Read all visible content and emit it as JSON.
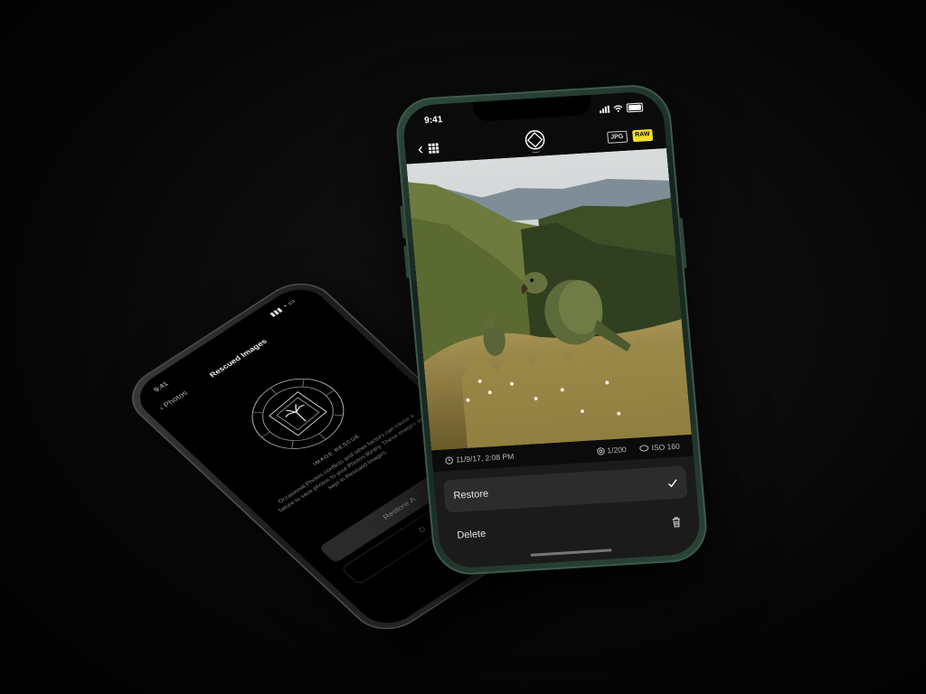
{
  "back_phone": {
    "status_time": "9:41",
    "nav_back_label": "Photos",
    "nav_title": "Rescued Images",
    "section_heading": "IMAGE RESCUE",
    "body_text": "Occasional Photos conflicts and other factors can cause a failure to save photos to your Photos library. These images are kept in Rescued Images.",
    "restore_label": "Restore A",
    "delete_label": "D"
  },
  "front_phone": {
    "status_time": "9:41",
    "toolbar": {
      "back_icon": "chevron-left-icon",
      "grid_icon": "grid-icon",
      "logo_icon": "app-logo-icon",
      "badge_jpg": "JPG",
      "badge_raw": "RAW"
    },
    "photo": {
      "icon": "photo-kea-parrots"
    },
    "exif": {
      "date": "11/9/17, 2:08 PM",
      "shutter": "1/200",
      "iso": "ISO 160"
    },
    "actions": {
      "restore_label": "Restore",
      "delete_label": "Delete"
    }
  },
  "colors": {
    "raw_badge": "#f2df2c",
    "frame_green": "#1b2e25"
  }
}
